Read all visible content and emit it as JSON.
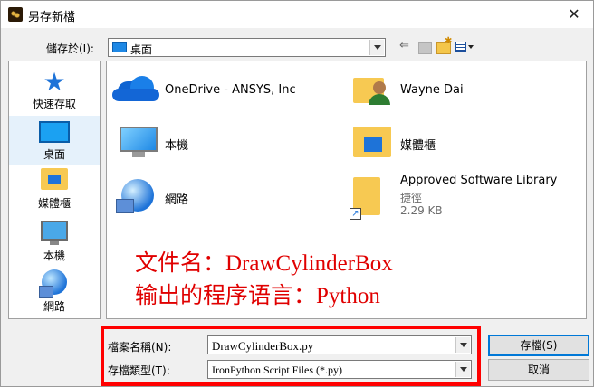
{
  "window": {
    "title": "另存新檔",
    "close_glyph": "✕"
  },
  "location": {
    "label": "儲存於(I):",
    "current": "桌面"
  },
  "toolbar": {
    "back_glyph": "⇐"
  },
  "places": [
    {
      "label": "快速存取",
      "icon": "quick-access-star-icon"
    },
    {
      "label": "桌面",
      "icon": "desktop-icon",
      "selected": true
    },
    {
      "label": "媒體櫃",
      "icon": "libraries-icon"
    },
    {
      "label": "本機",
      "icon": "this-pc-icon"
    },
    {
      "label": "網路",
      "icon": "network-icon"
    }
  ],
  "files": [
    {
      "label": "OneDrive - ANSYS, Inc",
      "icon": "onedrive-cloud-icon"
    },
    {
      "label": "Wayne Dai",
      "icon": "user-folder-icon"
    },
    {
      "label": "本機",
      "icon": "this-pc-icon"
    },
    {
      "label": "媒體櫃",
      "icon": "libraries-icon"
    },
    {
      "label": "網路",
      "icon": "network-icon"
    },
    {
      "label": "Approved Software Library",
      "type": "捷徑",
      "size": "2.29 KB",
      "icon": "shortcut-folder-icon"
    }
  ],
  "annotation": {
    "line1": "文件名：DrawCylinderBox",
    "line2": "输出的程序语言：Python",
    "color": "#e00000"
  },
  "filename": {
    "label": "檔案名稱(N):",
    "value": "DrawCylinderBox.py"
  },
  "filetype": {
    "label": "存檔類型(T):",
    "value": "IronPython Script Files (*.py)"
  },
  "buttons": {
    "save": "存檔(S)",
    "cancel": "取消"
  },
  "colors": {
    "highlight_border": "#ff0000",
    "accent": "#0078d7"
  }
}
